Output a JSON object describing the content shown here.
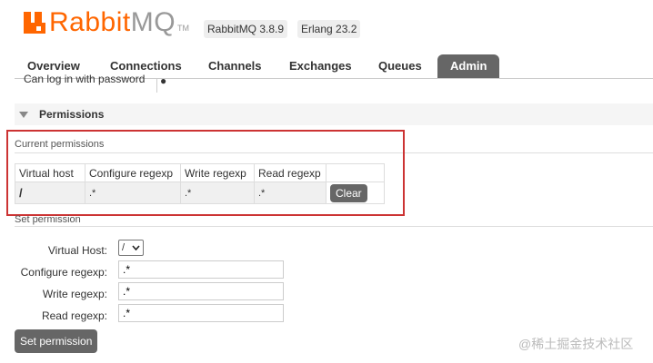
{
  "header": {
    "logo_rabbit": "Rabbit",
    "logo_mq": "MQ",
    "logo_tm": "TM",
    "version": "RabbitMQ 3.8.9",
    "erlang": "Erlang 23.2"
  },
  "nav": {
    "tabs": [
      "Overview",
      "Connections",
      "Channels",
      "Exchanges",
      "Queues",
      "Admin"
    ]
  },
  "clipped_row": {
    "label": "Can log in with password",
    "value": "●"
  },
  "permissions": {
    "title": "Permissions",
    "current_title": "Current permissions",
    "columns": [
      "Virtual host",
      "Configure regexp",
      "Write regexp",
      "Read regexp"
    ],
    "row": {
      "vhost": "/",
      "configure": ".*",
      "write": ".*",
      "read": ".*"
    },
    "clear_label": "Clear"
  },
  "set_permission": {
    "title": "Set permission",
    "vhost_label": "Virtual Host:",
    "vhost_value": "/",
    "configure_label": "Configure regexp:",
    "configure_value": ".*",
    "write_label": "Write regexp:",
    "write_value": ".*",
    "read_label": "Read regexp:",
    "read_value": ".*",
    "button_label": "Set permission"
  },
  "watermark": "@稀土掘金技术社区",
  "colors": {
    "brand": "#ff6600",
    "tab_active": "#666666",
    "highlight": "#cc3333"
  }
}
